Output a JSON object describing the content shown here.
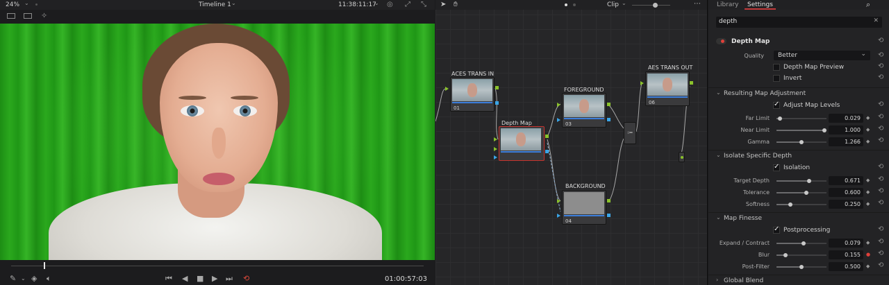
{
  "viewer": {
    "zoom": "24%",
    "timeline_name": "Timeline 1",
    "source_timecode": "11:38:11:17",
    "playhead_timecode": "01:00:57:03"
  },
  "nodes": {
    "mode": "Clip",
    "items": [
      {
        "label": "ACES TRANS IN",
        "number": "01"
      },
      {
        "label": "Depth Map",
        "number": ""
      },
      {
        "label": "FOREGROUND",
        "number": "03"
      },
      {
        "label": "BACKGROUND",
        "number": "04"
      },
      {
        "label": "AES TRANS OUT",
        "number": "06"
      }
    ]
  },
  "inspector": {
    "tabs": [
      "Library",
      "Settings"
    ],
    "search_value": "depth",
    "effect_title": "Depth Map",
    "quality_label": "Quality",
    "quality_value": "Better",
    "depth_map_preview_label": "Depth Map Preview",
    "invert_label": "Invert",
    "sections": {
      "resulting": "Resulting Map Adjustment",
      "isolate": "Isolate Specific Depth",
      "finesse": "Map Finesse",
      "global": "Global Blend"
    },
    "adjust_levels_label": "Adjust Map Levels",
    "isolation_label": "Isolation",
    "postprocessing_label": "Postprocessing",
    "params": {
      "far_limit": {
        "label": "Far Limit",
        "value": "0.029",
        "fraction": 0.03
      },
      "near_limit": {
        "label": "Near Limit",
        "value": "1.000",
        "fraction": 1.0
      },
      "gamma": {
        "label": "Gamma",
        "value": "1.266",
        "fraction": 0.5
      },
      "target_depth": {
        "label": "Target Depth",
        "value": "0.671",
        "fraction": 0.671
      },
      "tolerance": {
        "label": "Tolerance",
        "value": "0.600",
        "fraction": 0.6
      },
      "softness": {
        "label": "Softness",
        "value": "0.250",
        "fraction": 0.25
      },
      "expand_contract": {
        "label": "Expand / Contract",
        "value": "0.079",
        "fraction": 0.54
      },
      "blur": {
        "label": "Blur",
        "value": "0.155",
        "fraction": 0.155
      },
      "post_filter": {
        "label": "Post-Filter",
        "value": "0.500",
        "fraction": 0.5
      }
    }
  },
  "colors": {
    "accent_red": "#c33a3a",
    "node_green": "#8bc22b",
    "node_blue": "#3aa5e6"
  }
}
